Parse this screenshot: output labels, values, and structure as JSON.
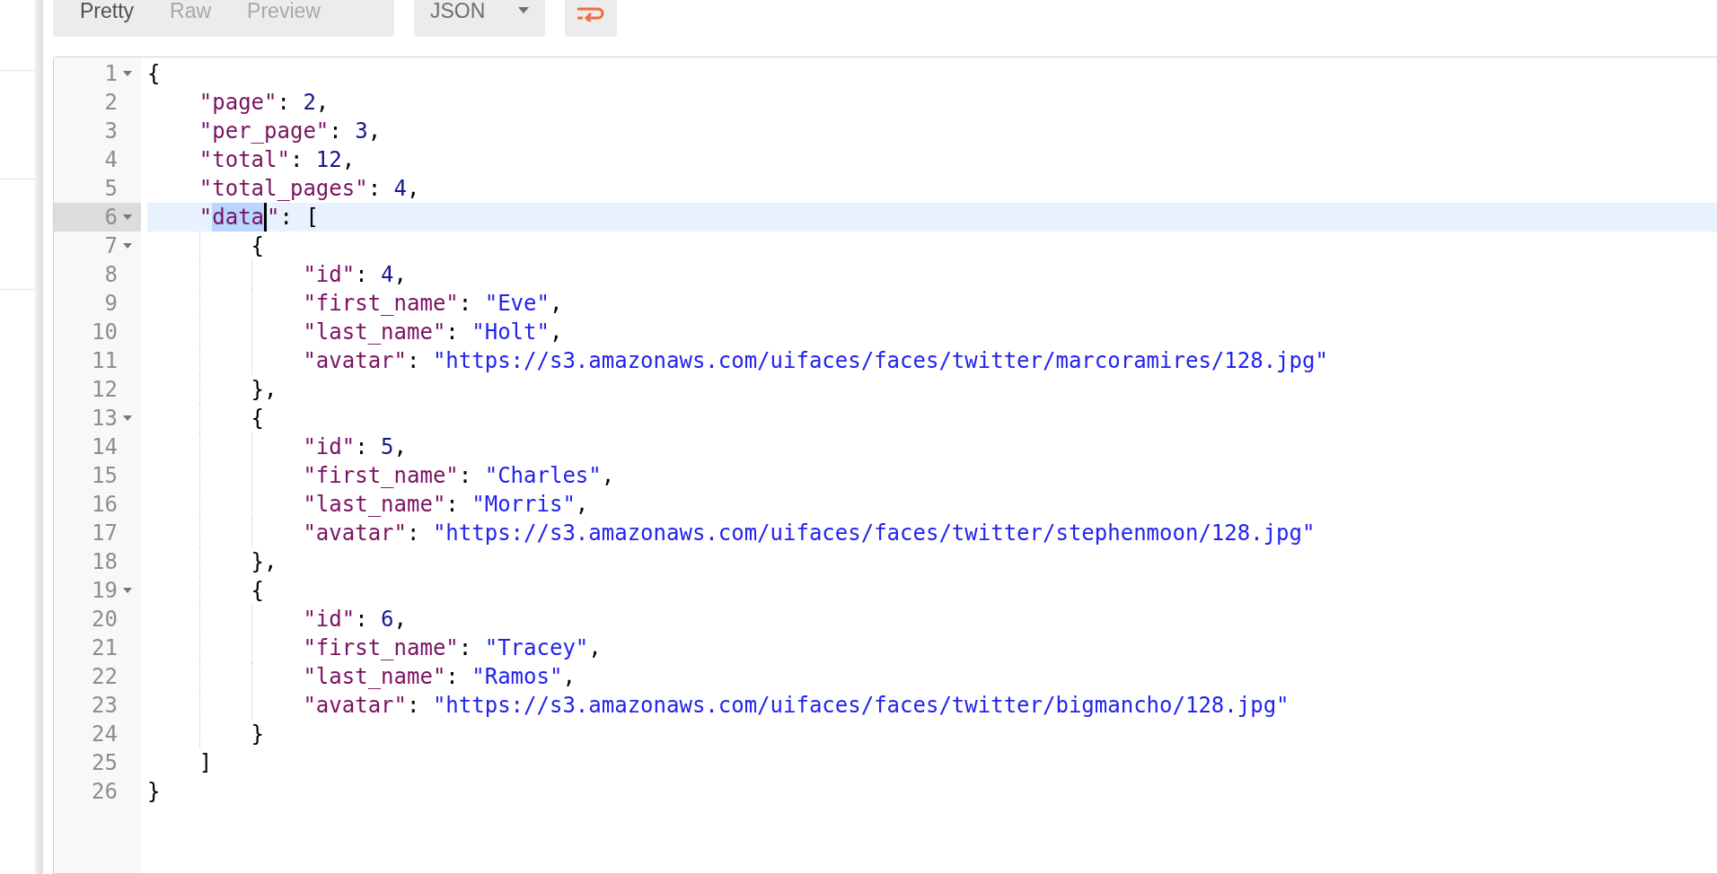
{
  "toolbar": {
    "view_tabs": [
      {
        "label": "Pretty",
        "selected": true
      },
      {
        "label": "Raw",
        "selected": false
      },
      {
        "label": "Preview",
        "selected": false
      }
    ],
    "format_dropdown": {
      "value": "JSON"
    }
  },
  "editor": {
    "lines": [
      {
        "number": "1",
        "foldable": true,
        "selected": false,
        "tokens": [
          {
            "kind": "open",
            "text": "{"
          }
        ]
      },
      {
        "number": "2",
        "foldable": false,
        "selected": false,
        "tokens": [
          {
            "kind": "key",
            "text": "\"page\""
          },
          {
            "kind": "punct",
            "text": ": "
          },
          {
            "kind": "number",
            "text": "2"
          },
          {
            "kind": "punct",
            "text": ","
          }
        ]
      },
      {
        "number": "3",
        "foldable": false,
        "selected": false,
        "tokens": [
          {
            "kind": "key",
            "text": "\"per_page\""
          },
          {
            "kind": "punct",
            "text": ": "
          },
          {
            "kind": "number",
            "text": "3"
          },
          {
            "kind": "punct",
            "text": ","
          }
        ]
      },
      {
        "number": "4",
        "foldable": false,
        "selected": false,
        "tokens": [
          {
            "kind": "key",
            "text": "\"total\""
          },
          {
            "kind": "punct",
            "text": ": "
          },
          {
            "kind": "number",
            "text": "12"
          },
          {
            "kind": "punct",
            "text": ","
          }
        ]
      },
      {
        "number": "5",
        "foldable": false,
        "selected": false,
        "tokens": [
          {
            "kind": "key",
            "text": "\"total_pages\""
          },
          {
            "kind": "punct",
            "text": ": "
          },
          {
            "kind": "number",
            "text": "4"
          },
          {
            "kind": "punct",
            "text": ","
          }
        ]
      },
      {
        "number": "6",
        "foldable": true,
        "selected": true,
        "tokens": [
          {
            "kind": "key",
            "text": "\""
          },
          {
            "kind": "key",
            "text": "data",
            "highlighted": true
          },
          {
            "kind": "key",
            "text": "\""
          },
          {
            "kind": "punct",
            "text": ": "
          },
          {
            "kind": "open",
            "text": "["
          }
        ]
      },
      {
        "number": "7",
        "foldable": true,
        "selected": false,
        "tokens": [
          {
            "kind": "open",
            "text": "{"
          }
        ]
      },
      {
        "number": "8",
        "foldable": false,
        "selected": false,
        "tokens": [
          {
            "kind": "key",
            "text": "\"id\""
          },
          {
            "kind": "punct",
            "text": ": "
          },
          {
            "kind": "number",
            "text": "4"
          },
          {
            "kind": "punct",
            "text": ","
          }
        ]
      },
      {
        "number": "9",
        "foldable": false,
        "selected": false,
        "tokens": [
          {
            "kind": "key",
            "text": "\"first_name\""
          },
          {
            "kind": "punct",
            "text": ": "
          },
          {
            "kind": "string",
            "text": "\"Eve\""
          },
          {
            "kind": "punct",
            "text": ","
          }
        ]
      },
      {
        "number": "10",
        "foldable": false,
        "selected": false,
        "tokens": [
          {
            "kind": "key",
            "text": "\"last_name\""
          },
          {
            "kind": "punct",
            "text": ": "
          },
          {
            "kind": "string",
            "text": "\"Holt\""
          },
          {
            "kind": "punct",
            "text": ","
          }
        ]
      },
      {
        "number": "11",
        "foldable": false,
        "selected": false,
        "tokens": [
          {
            "kind": "key",
            "text": "\"avatar\""
          },
          {
            "kind": "punct",
            "text": ": "
          },
          {
            "kind": "string",
            "text": "\"https://s3.amazonaws.com/uifaces/faces/twitter/marcoramires/128.jpg\""
          }
        ]
      },
      {
        "number": "12",
        "foldable": false,
        "selected": false,
        "tokens": [
          {
            "kind": "close",
            "text": "}"
          },
          {
            "kind": "punct",
            "text": ","
          }
        ]
      },
      {
        "number": "13",
        "foldable": true,
        "selected": false,
        "tokens": [
          {
            "kind": "open",
            "text": "{"
          }
        ]
      },
      {
        "number": "14",
        "foldable": false,
        "selected": false,
        "tokens": [
          {
            "kind": "key",
            "text": "\"id\""
          },
          {
            "kind": "punct",
            "text": ": "
          },
          {
            "kind": "number",
            "text": "5"
          },
          {
            "kind": "punct",
            "text": ","
          }
        ]
      },
      {
        "number": "15",
        "foldable": false,
        "selected": false,
        "tokens": [
          {
            "kind": "key",
            "text": "\"first_name\""
          },
          {
            "kind": "punct",
            "text": ": "
          },
          {
            "kind": "string",
            "text": "\"Charles\""
          },
          {
            "kind": "punct",
            "text": ","
          }
        ]
      },
      {
        "number": "16",
        "foldable": false,
        "selected": false,
        "tokens": [
          {
            "kind": "key",
            "text": "\"last_name\""
          },
          {
            "kind": "punct",
            "text": ": "
          },
          {
            "kind": "string",
            "text": "\"Morris\""
          },
          {
            "kind": "punct",
            "text": ","
          }
        ]
      },
      {
        "number": "17",
        "foldable": false,
        "selected": false,
        "tokens": [
          {
            "kind": "key",
            "text": "\"avatar\""
          },
          {
            "kind": "punct",
            "text": ": "
          },
          {
            "kind": "string",
            "text": "\"https://s3.amazonaws.com/uifaces/faces/twitter/stephenmoon/128.jpg\""
          }
        ]
      },
      {
        "number": "18",
        "foldable": false,
        "selected": false,
        "tokens": [
          {
            "kind": "close",
            "text": "}"
          },
          {
            "kind": "punct",
            "text": ","
          }
        ]
      },
      {
        "number": "19",
        "foldable": true,
        "selected": false,
        "tokens": [
          {
            "kind": "open",
            "text": "{"
          }
        ]
      },
      {
        "number": "20",
        "foldable": false,
        "selected": false,
        "tokens": [
          {
            "kind": "key",
            "text": "\"id\""
          },
          {
            "kind": "punct",
            "text": ": "
          },
          {
            "kind": "number",
            "text": "6"
          },
          {
            "kind": "punct",
            "text": ","
          }
        ]
      },
      {
        "number": "21",
        "foldable": false,
        "selected": false,
        "tokens": [
          {
            "kind": "key",
            "text": "\"first_name\""
          },
          {
            "kind": "punct",
            "text": ": "
          },
          {
            "kind": "string",
            "text": "\"Tracey\""
          },
          {
            "kind": "punct",
            "text": ","
          }
        ]
      },
      {
        "number": "22",
        "foldable": false,
        "selected": false,
        "tokens": [
          {
            "kind": "key",
            "text": "\"last_name\""
          },
          {
            "kind": "punct",
            "text": ": "
          },
          {
            "kind": "string",
            "text": "\"Ramos\""
          },
          {
            "kind": "punct",
            "text": ","
          }
        ]
      },
      {
        "number": "23",
        "foldable": false,
        "selected": false,
        "tokens": [
          {
            "kind": "key",
            "text": "\"avatar\""
          },
          {
            "kind": "punct",
            "text": ": "
          },
          {
            "kind": "string",
            "text": "\"https://s3.amazonaws.com/uifaces/faces/twitter/bigmancho/128.jpg\""
          }
        ]
      },
      {
        "number": "24",
        "foldable": false,
        "selected": false,
        "tokens": [
          {
            "kind": "close",
            "text": "}"
          }
        ]
      },
      {
        "number": "25",
        "foldable": false,
        "selected": false,
        "tokens": [
          {
            "kind": "close",
            "text": "]"
          }
        ]
      },
      {
        "number": "26",
        "foldable": false,
        "selected": false,
        "tokens": [
          {
            "kind": "close",
            "text": "}"
          }
        ]
      }
    ]
  }
}
